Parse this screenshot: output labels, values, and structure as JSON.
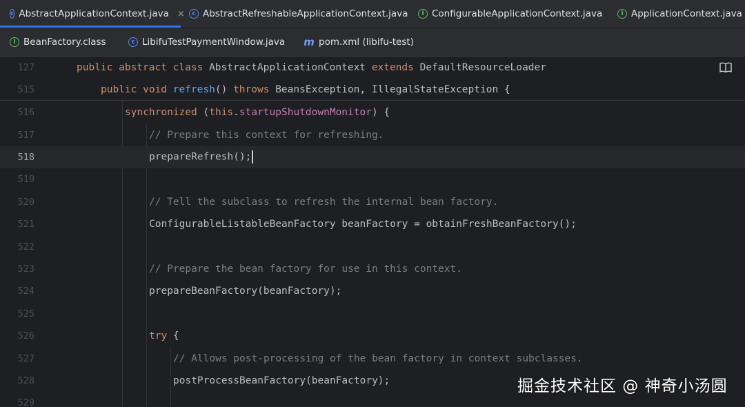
{
  "tabs_row1": [
    {
      "label": "AbstractApplicationContext.java",
      "icon": "class-c",
      "glyph": "c",
      "active": true,
      "closable": true
    },
    {
      "label": "AbstractRefreshableApplicationContext.java",
      "icon": "class-c",
      "glyph": "c",
      "active": false
    },
    {
      "label": "ConfigurableApplicationContext.java",
      "icon": "iface-i",
      "glyph": "I",
      "active": false
    },
    {
      "label": "ApplicationContext.java",
      "icon": "iface-i",
      "glyph": "I",
      "active": false
    }
  ],
  "tabs_row2": [
    {
      "label": "BeanFactory.class",
      "icon": "iface-i",
      "glyph": "I"
    },
    {
      "label": "LibifuTestPaymentWindow.java",
      "icon": "class-c",
      "glyph": "c"
    },
    {
      "label": "pom.xml (libifu-test)",
      "icon": "maven-m",
      "glyph": "m"
    }
  ],
  "tab_close_glyph": "×",
  "sticky_lines": [
    {
      "number": "127",
      "tokens": [
        {
          "t": "public abstract class ",
          "c": "kw"
        },
        {
          "t": "AbstractApplicationContext "
        },
        {
          "t": "extends ",
          "c": "kw"
        },
        {
          "t": "DefaultResourceLoader"
        }
      ]
    },
    {
      "number": "515",
      "tokens": [
        {
          "t": "public void ",
          "c": "kw"
        },
        {
          "t": "refresh",
          "c": "fn"
        },
        {
          "t": "() "
        },
        {
          "t": "throws ",
          "c": "kw"
        },
        {
          "t": "BeansException, IllegalStateException {"
        }
      ]
    }
  ],
  "lines": [
    {
      "number": "516",
      "indent": 2,
      "tokens": [
        {
          "t": "synchronized ",
          "c": "kw"
        },
        {
          "t": "("
        },
        {
          "t": "this",
          "c": "kw"
        },
        {
          "t": "."
        },
        {
          "t": "startupShutdownMonitor",
          "c": "field"
        },
        {
          "t": ") {"
        }
      ]
    },
    {
      "number": "517",
      "indent": 3,
      "tokens": [
        {
          "t": "// Prepare this context for refreshing.",
          "c": "cm"
        }
      ]
    },
    {
      "number": "518",
      "indent": 3,
      "current": true,
      "tokens": [
        {
          "t": "prepareRefresh();"
        }
      ]
    },
    {
      "number": "519",
      "indent": 3,
      "tokens": []
    },
    {
      "number": "520",
      "indent": 3,
      "tokens": [
        {
          "t": "// Tell the subclass to refresh the internal bean factory.",
          "c": "cm"
        }
      ]
    },
    {
      "number": "521",
      "indent": 3,
      "tokens": [
        {
          "t": "ConfigurableListableBeanFactory beanFactory = obtainFreshBeanFactory();"
        }
      ]
    },
    {
      "number": "522",
      "indent": 3,
      "tokens": []
    },
    {
      "number": "523",
      "indent": 3,
      "tokens": [
        {
          "t": "// Prepare the bean factory for use in this context.",
          "c": "cm"
        }
      ]
    },
    {
      "number": "524",
      "indent": 3,
      "tokens": [
        {
          "t": "prepareBeanFactory(beanFactory);"
        }
      ]
    },
    {
      "number": "525",
      "indent": 3,
      "tokens": []
    },
    {
      "number": "526",
      "indent": 3,
      "tokens": [
        {
          "t": "try ",
          "c": "kw"
        },
        {
          "t": "{"
        }
      ]
    },
    {
      "number": "527",
      "indent": 4,
      "tokens": [
        {
          "t": "// Allows post-processing of the bean factory in context subclasses.",
          "c": "cm"
        }
      ]
    },
    {
      "number": "528",
      "indent": 4,
      "tokens": [
        {
          "t": "postProcessBeanFactory(beanFactory);"
        }
      ]
    },
    {
      "number": "529",
      "indent": 4,
      "tokens": []
    }
  ],
  "reader_mode_icon": "book-icon",
  "watermark": "掘金技术社区 @ 神奇小汤圆",
  "colors": {
    "keyword": "#cf8e6d",
    "method": "#56a8f5",
    "field": "#c77dbb",
    "comment": "#7a7e85",
    "text": "#bcbec4",
    "accent": "#3574f0"
  }
}
